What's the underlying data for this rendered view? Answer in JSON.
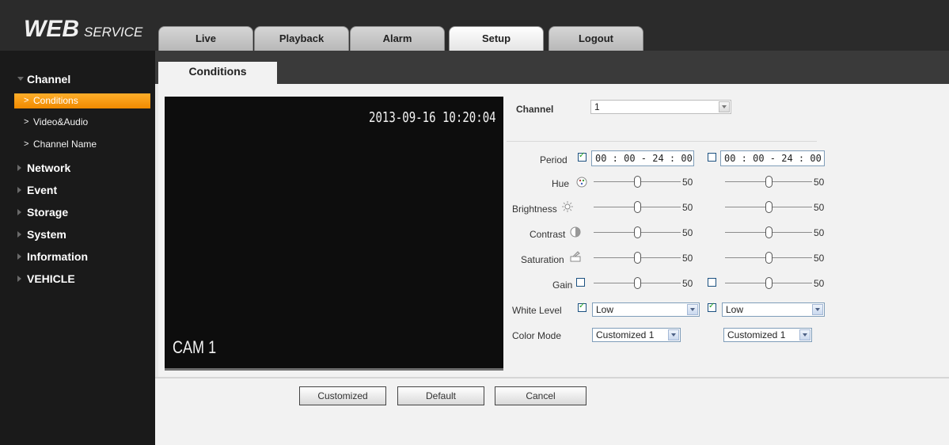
{
  "logo": {
    "web": "WEB",
    "service": "SERVICE"
  },
  "main_tabs": [
    {
      "label": "Live"
    },
    {
      "label": "Playback"
    },
    {
      "label": "Alarm"
    },
    {
      "label": "Setup"
    },
    {
      "label": "Logout"
    }
  ],
  "active_main_tab": "Setup",
  "sidebar": {
    "channel": "Channel",
    "channel_items": [
      {
        "label": "Conditions",
        "arrow": ">"
      },
      {
        "label": "Video&Audio",
        "arrow": ">"
      },
      {
        "label": "Channel Name",
        "arrow": ">"
      }
    ],
    "sections": [
      {
        "label": "Network"
      },
      {
        "label": "Event"
      },
      {
        "label": "Storage"
      },
      {
        "label": "System"
      },
      {
        "label": "Information"
      },
      {
        "label": "VEHICLE"
      }
    ]
  },
  "sub_tab": "Conditions",
  "preview": {
    "timestamp": "2013-09-16 10:20:04",
    "camera": "CAM 1"
  },
  "form": {
    "channel_label": "Channel",
    "channel_value": "1",
    "period_label": "Period",
    "period_1": {
      "checked": true,
      "value": "00 : 00 - 24 : 00"
    },
    "period_2": {
      "checked": false,
      "value": "00 : 00 - 24 : 00"
    },
    "hue_label": "Hue",
    "brightness_label": "Brightness",
    "contrast_label": "Contrast",
    "saturation_label": "Saturation",
    "gain_label": "Gain",
    "gain_1_checked": false,
    "gain_2_checked": false,
    "sliders": {
      "hue": [
        "50",
        "50"
      ],
      "brightness": [
        "50",
        "50"
      ],
      "contrast": [
        "50",
        "50"
      ],
      "saturation": [
        "50",
        "50"
      ],
      "gain": [
        "50",
        "50"
      ]
    },
    "slider_level": 0.5,
    "white_level_label": "White Level",
    "white_level_1": {
      "checked": true,
      "value": "Low"
    },
    "white_level_2": {
      "checked": true,
      "value": "Low"
    },
    "color_mode_label": "Color Mode",
    "color_mode_1": "Customized 1",
    "color_mode_2": "Customized 1"
  },
  "buttons": {
    "customized": "Customized",
    "default": "Default",
    "cancel": "Cancel"
  },
  "icons": [
    "hue-icon",
    "brightness-icon",
    "contrast-icon",
    "saturation-icon",
    "checkbox-check-icon",
    "dropdown-arrow-icon",
    "triangle-icon"
  ],
  "colors": {
    "active_sidebar": "#f08a00",
    "topbar": "#2b2b2b",
    "sidebar": "#1a1a1a",
    "check": "#21a121"
  }
}
